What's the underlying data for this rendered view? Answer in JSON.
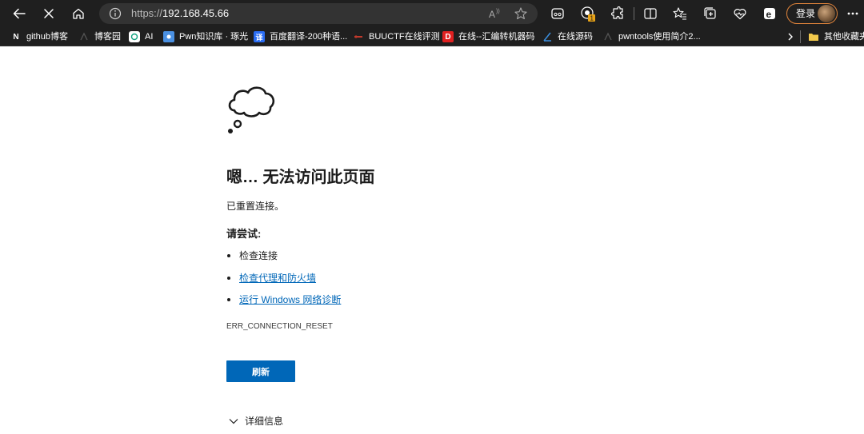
{
  "browser": {
    "url_scheme": "https://",
    "url_host": "192.168.45.66",
    "login_label": "登录",
    "toolbar_icons": [
      "back-icon",
      "stop-icon",
      "home-icon",
      "info-icon",
      "read-aloud-icon",
      "favorite-star-icon",
      "games-icon",
      "extension-badge-icon",
      "extensions-icon",
      "split-screen-icon",
      "favorites-icon",
      "collections-icon",
      "browser-essentials-icon",
      "edge-icon",
      "more-icon"
    ],
    "extension_badge": "1"
  },
  "bookmarks": [
    {
      "label": "github博客",
      "icon": "N"
    },
    {
      "label": "博客园",
      "icon": ""
    },
    {
      "label": "AI",
      "icon": ""
    },
    {
      "label": "Pwn知识库 · 琢光",
      "icon": ""
    },
    {
      "label": "百度翻译-200种语...",
      "icon": "译"
    },
    {
      "label": "BUUCTF在线评测",
      "icon": ""
    },
    {
      "label": "在线--汇编转机器码",
      "icon": "D"
    },
    {
      "label": "在线源码",
      "icon": ""
    },
    {
      "label": "pwntools使用简介2...",
      "icon": ""
    },
    {
      "label": "其他收藏夹",
      "icon": ""
    }
  ],
  "colors": {
    "toolbar_bg": "#1f1f1f",
    "address_bg": "#333333",
    "link": "#0067b8",
    "button_bg": "#0067b8",
    "login_border": "#e0843b"
  },
  "error_page": {
    "title": "嗯… 无法访问此页面",
    "subtitle": "已重置连接。",
    "try_heading": "请尝试:",
    "suggestions": [
      {
        "text": "检查连接",
        "is_link": false
      },
      {
        "text": "检查代理和防火墙",
        "is_link": true
      },
      {
        "text": "运行 Windows 网络诊断",
        "is_link": true
      }
    ],
    "error_code": "ERR_CONNECTION_RESET",
    "refresh_label": "刷新",
    "details_label": "详细信息"
  }
}
